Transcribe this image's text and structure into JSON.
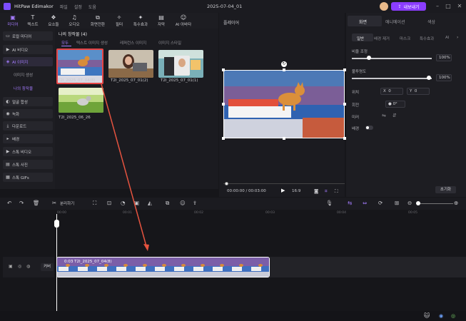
{
  "app": {
    "name": "HitPaw Edimakor",
    "menu": [
      "파일",
      "설정",
      "도움"
    ],
    "doc_title": "2025-07-04_01",
    "export_label": "내보내기"
  },
  "toolbar": [
    {
      "label": "미디어",
      "icon": "media-icon",
      "active": true
    },
    {
      "label": "텍스트",
      "icon": "text-icon"
    },
    {
      "label": "요소들",
      "icon": "elements-icon"
    },
    {
      "label": "오디오",
      "icon": "audio-icon"
    },
    {
      "label": "화면전환",
      "icon": "transition-icon"
    },
    {
      "label": "필터",
      "icon": "filter-icon"
    },
    {
      "label": "특수효과",
      "icon": "effects-icon"
    },
    {
      "label": "자막",
      "icon": "subtitle-icon"
    },
    {
      "label": "AI 아바타",
      "icon": "avatar-icon"
    }
  ],
  "leftnav": {
    "items": [
      {
        "label": "로컬 미디어",
        "icon": "folder-icon"
      },
      {
        "label": "AI 비디오",
        "icon": "ai-video-icon"
      },
      {
        "label": "AI 이미지",
        "icon": "ai-image-icon",
        "active": true
      },
      {
        "label": "얼굴 합성",
        "icon": "face-icon"
      },
      {
        "label": "녹화",
        "icon": "record-icon"
      },
      {
        "label": "다운로드",
        "icon": "download-icon"
      },
      {
        "label": "배경",
        "icon": "background-icon"
      },
      {
        "label": "스톡 비디오",
        "icon": "stock-video-icon"
      },
      {
        "label": "스톡 사진",
        "icon": "stock-photo-icon"
      },
      {
        "label": "스톡 GIFs",
        "icon": "gif-icon"
      }
    ],
    "subitems": [
      {
        "label": "이미지 생성"
      },
      {
        "label": "나의 창작물",
        "active": true
      }
    ]
  },
  "media": {
    "title": "나의 창작물 (4)",
    "tabs": [
      "모두",
      "텍스트 이미지 생성",
      "레퍼런스 이미지",
      "이미지 스타일"
    ],
    "items": [
      {
        "label": "T2I_2025_07_04(8)",
        "selected": true
      },
      {
        "label": "T2I_2025_07_01(2)"
      },
      {
        "label": "T2I_2025_07_01(1)"
      },
      {
        "label": "T2I_2025_06_26"
      }
    ]
  },
  "preview": {
    "title": "플레이어",
    "timecode": "00:00:00 / 00:03:00",
    "ratio": "16:9",
    "progress": 0.0
  },
  "right": {
    "tabs": [
      "화면",
      "애니메이션",
      "색상"
    ],
    "subtabs": [
      "일반",
      "배경 제거",
      "마스크",
      "특수효과",
      "AI"
    ],
    "opacity_label": "비율 조정",
    "opacity_value": "100%",
    "opacity_level": 1.0,
    "blur_label": "불투명도",
    "blur_value": "100%",
    "blur_level": 1.0,
    "position_label": "위치",
    "pos_x_label": "X",
    "pos_x": "0",
    "pos_y_label": "Y",
    "pos_y": "0",
    "rotate_label": "회전",
    "rotate_value": "0°",
    "mirror_label": "미러",
    "bg_label": "배경",
    "reset_label": "초기화"
  },
  "timeline": {
    "split_label": "분리하기",
    "ticks": [
      "00:00",
      "00:01",
      "00:02",
      "00:03",
      "00:04",
      "00:05"
    ],
    "cover_label": "커버",
    "clip_label": "0:03 T2I_2025_07_04(8)"
  },
  "colors": {
    "accent": "#8b3dff",
    "selection": "#e64545",
    "arrow": "#e5533f"
  }
}
